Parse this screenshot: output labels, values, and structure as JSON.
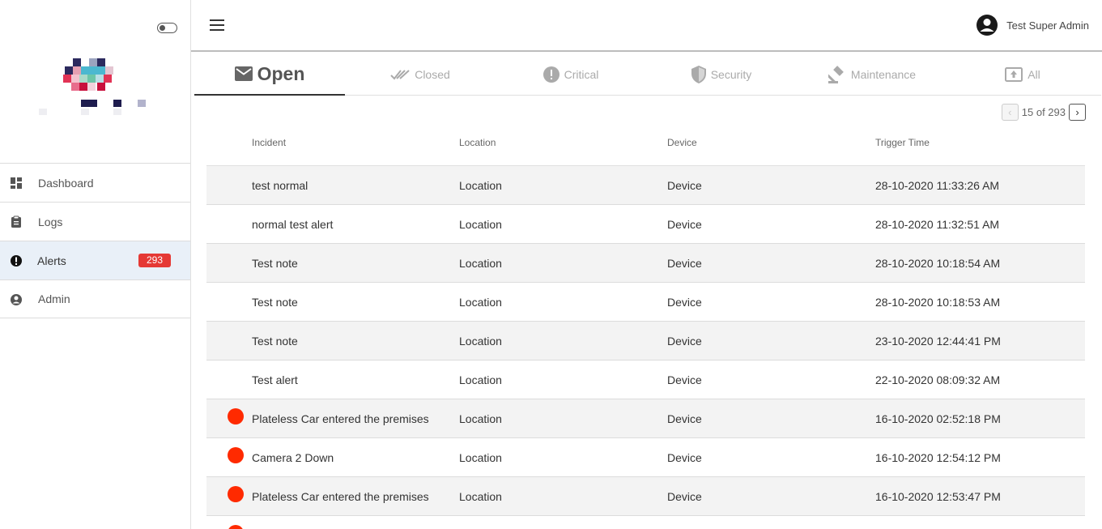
{
  "header": {
    "user_name": "Test Super Admin"
  },
  "sidebar": {
    "items": [
      {
        "label": "Dashboard",
        "icon": "dashboard-icon"
      },
      {
        "label": "Logs",
        "icon": "clipboard-icon"
      },
      {
        "label": "Alerts",
        "icon": "alert-circle-icon",
        "badge": "293",
        "active": true
      },
      {
        "label": "Admin",
        "icon": "account-circle-icon"
      }
    ]
  },
  "tabs": [
    {
      "label": "Open",
      "icon": "mail-icon",
      "active": true
    },
    {
      "label": "Closed",
      "icon": "double-check-icon"
    },
    {
      "label": "Critical",
      "icon": "exclamation-icon"
    },
    {
      "label": "Security",
      "icon": "shield-icon"
    },
    {
      "label": "Maintenance",
      "icon": "gavel-icon"
    },
    {
      "label": "All",
      "icon": "upload-box-icon"
    }
  ],
  "pagination": {
    "text": "15 of 293",
    "prev": "‹",
    "next": "›"
  },
  "table": {
    "columns": [
      "Incident",
      "Location",
      "Device",
      "Trigger Time"
    ],
    "rows": [
      {
        "incident": "test normal",
        "location": "Location",
        "device": "Device",
        "time": "28-10-2020 11:33:26 AM",
        "critical": false
      },
      {
        "incident": "normal test alert",
        "location": "Location",
        "device": "Device",
        "time": "28-10-2020 11:32:51 AM",
        "critical": false
      },
      {
        "incident": "Test note",
        "location": "Location",
        "device": "Device",
        "time": "28-10-2020 10:18:54 AM",
        "critical": false
      },
      {
        "incident": "Test note",
        "location": "Location",
        "device": "Device",
        "time": "28-10-2020 10:18:53 AM",
        "critical": false
      },
      {
        "incident": "Test note",
        "location": "Location",
        "device": "Device",
        "time": "23-10-2020 12:44:41 PM",
        "critical": false
      },
      {
        "incident": "Test alert",
        "location": "Location",
        "device": "Device",
        "time": "22-10-2020 08:09:32 AM",
        "critical": false
      },
      {
        "incident": "Plateless Car entered the premises",
        "location": "Location",
        "device": "Device",
        "time": "16-10-2020 02:52:18 PM",
        "critical": true
      },
      {
        "incident": "Camera 2 Down",
        "location": "Location",
        "device": "Device",
        "time": "16-10-2020 12:54:12 PM",
        "critical": true
      },
      {
        "incident": "Plateless Car entered the premises",
        "location": "Location",
        "device": "Device",
        "time": "16-10-2020 12:53:47 PM",
        "critical": true
      },
      {
        "incident": "",
        "location": "",
        "device": "",
        "time": "",
        "critical": true
      }
    ]
  },
  "colors": {
    "accent": "#e53935",
    "critical_dot": "#ff2a00",
    "active_nav_bg": "#e9f0f8"
  }
}
